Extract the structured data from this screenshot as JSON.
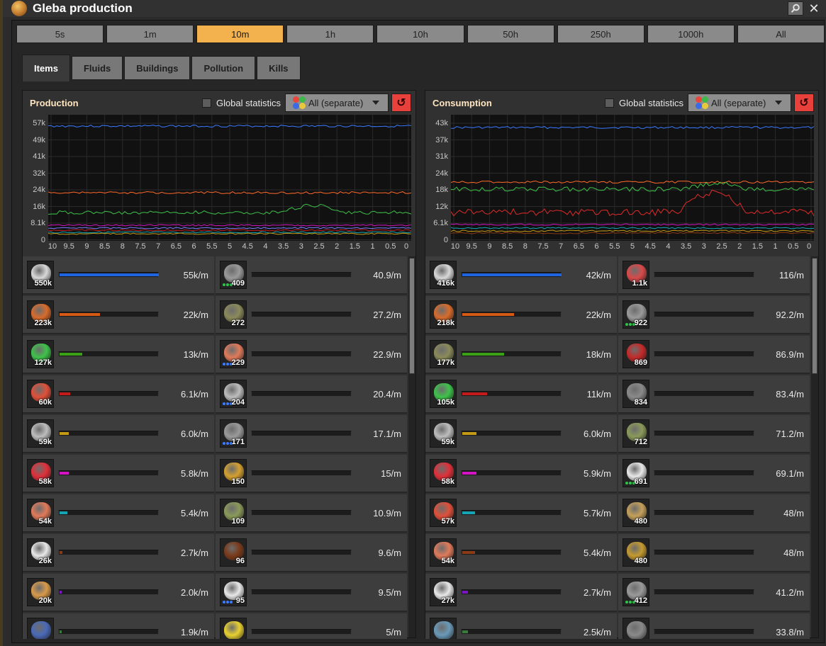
{
  "window": {
    "title": "Gleba production",
    "icon": "gleba-planet-icon"
  },
  "time_ranges": [
    {
      "label": "5s",
      "active": false
    },
    {
      "label": "1m",
      "active": false
    },
    {
      "label": "10m",
      "active": true
    },
    {
      "label": "1h",
      "active": false
    },
    {
      "label": "10h",
      "active": false
    },
    {
      "label": "50h",
      "active": false
    },
    {
      "label": "250h",
      "active": false
    },
    {
      "label": "1000h",
      "active": false
    },
    {
      "label": "All",
      "active": false
    }
  ],
  "tabs": [
    {
      "label": "Items",
      "active": true
    },
    {
      "label": "Fluids",
      "active": false
    },
    {
      "label": "Buildings",
      "active": false
    },
    {
      "label": "Pollution",
      "active": false
    },
    {
      "label": "Kills",
      "active": false
    }
  ],
  "production": {
    "title": "Production",
    "global_label": "Global statistics",
    "dropdown": "All (separate)",
    "y_ticks": [
      "57k",
      "49k",
      "41k",
      "32k",
      "24k",
      "16k",
      "8.1k",
      "0"
    ],
    "x_ticks": [
      "10",
      "9.5",
      "9",
      "8.5",
      "8",
      "7.5",
      "7",
      "6.5",
      "6",
      "5.5",
      "5",
      "4.5",
      "4",
      "3.5",
      "3",
      "2.5",
      "2",
      "1.5",
      "1",
      "0.5",
      "0"
    ],
    "rows": [
      [
        {
          "count": "550k",
          "rate": "55k/m",
          "fill": 1.0,
          "bar": "#1e63e0",
          "icon": "stone-icon",
          "ic": "#d8d8d8",
          "dots": ""
        },
        {
          "count": "409",
          "rate": "40.9/m",
          "fill": 0,
          "bar": "#777",
          "icon": "iron-stick-icon",
          "ic": "#9a9a9a",
          "dots": "#2cc44a"
        }
      ],
      [
        {
          "count": "223k",
          "rate": "22k/m",
          "fill": 0.41,
          "bar": "#d75a14",
          "icon": "yumako-icon",
          "ic": "#d86b2c",
          "dots": ""
        },
        {
          "count": "272",
          "rate": "27.2/m",
          "fill": 0,
          "bar": "#777",
          "icon": "jellynut-seed-icon",
          "ic": "#8a8a5a",
          "dots": ""
        }
      ],
      [
        {
          "count": "127k",
          "rate": "13k/m",
          "fill": 0.23,
          "bar": "#3aa114",
          "icon": "nutrients-icon",
          "ic": "#3ec24a",
          "dots": ""
        },
        {
          "count": "229",
          "rate": "22.9/m",
          "fill": 0,
          "bar": "#777",
          "icon": "copper-plate-icon",
          "ic": "#e07a5a",
          "dots": "#3a7aff"
        }
      ],
      [
        {
          "count": "60k",
          "rate": "6.1k/m",
          "fill": 0.11,
          "bar": "#c41a1a",
          "icon": "bioflux-icon",
          "ic": "#e0503a",
          "dots": ""
        },
        {
          "count": "204",
          "rate": "20.4/m",
          "fill": 0,
          "bar": "#777",
          "icon": "iron-plate-icon",
          "ic": "#bdbdbd",
          "dots": "#3a7aff"
        }
      ],
      [
        {
          "count": "59k",
          "rate": "6.0k/m",
          "fill": 0.09,
          "bar": "#c49a14",
          "icon": "iron-plate-icon",
          "ic": "#bdbdbd",
          "dots": ""
        },
        {
          "count": "171",
          "rate": "17.1/m",
          "fill": 0,
          "bar": "#777",
          "icon": "iron-stick-icon",
          "ic": "#9a9a9a",
          "dots": "#3a7aff"
        }
      ],
      [
        {
          "count": "58k",
          "rate": "5.8k/m",
          "fill": 0.09,
          "bar": "#d414c4",
          "icon": "jellynut-icon",
          "ic": "#e0303a",
          "dots": ""
        },
        {
          "count": "150",
          "rate": "15/m",
          "fill": 0,
          "bar": "#777",
          "icon": "agricultural-science-pack-icon",
          "ic": "#d4a030",
          "dots": ""
        }
      ],
      [
        {
          "count": "54k",
          "rate": "5.4k/m",
          "fill": 0.08,
          "bar": "#14a4b4",
          "icon": "copper-plate-icon",
          "ic": "#e07a5a",
          "dots": ""
        },
        {
          "count": "109",
          "rate": "10.9/m",
          "fill": 0,
          "bar": "#777",
          "icon": "rocket-part-icon",
          "ic": "#8a9a5a",
          "dots": ""
        }
      ],
      [
        {
          "count": "26k",
          "rate": "2.7k/m",
          "fill": 0.03,
          "bar": "#8a3a14",
          "icon": "plastic-bar-icon",
          "ic": "#e8e8e8",
          "dots": ""
        },
        {
          "count": "96",
          "rate": "9.6/m",
          "fill": 0,
          "bar": "#777",
          "icon": "carbon-fiber-icon",
          "ic": "#7a3a1a",
          "dots": ""
        }
      ],
      [
        {
          "count": "20k",
          "rate": "2.0k/m",
          "fill": 0.02,
          "bar": "#7a14c4",
          "icon": "yumako-mash-icon",
          "ic": "#d89a4a",
          "dots": ""
        },
        {
          "count": "95",
          "rate": "9.5/m",
          "fill": 0,
          "bar": "#777",
          "icon": "plastic-bar-icon",
          "ic": "#e8e8e8",
          "dots": "#3a7aff"
        }
      ],
      [
        {
          "count": "",
          "rate": "1.9k/m",
          "fill": 0.02,
          "bar": "#3a7a3a",
          "icon": "carbon-icon",
          "ic": "#4a6ab8",
          "dots": ""
        },
        {
          "count": "",
          "rate": "5/m",
          "fill": 0,
          "bar": "#777",
          "icon": "sulfur-icon",
          "ic": "#e8d030",
          "dots": ""
        }
      ]
    ]
  },
  "consumption": {
    "title": "Consumption",
    "global_label": "Global statistics",
    "dropdown": "All (separate)",
    "y_ticks": [
      "43k",
      "37k",
      "31k",
      "24k",
      "18k",
      "12k",
      "6.1k",
      "0"
    ],
    "x_ticks": [
      "10",
      "9.5",
      "9",
      "8.5",
      "8",
      "7.5",
      "7",
      "6.5",
      "6",
      "5.5",
      "5",
      "4.5",
      "4",
      "3.5",
      "3",
      "2.5",
      "2",
      "1.5",
      "1",
      "0.5",
      "0"
    ],
    "rows": [
      [
        {
          "count": "416k",
          "rate": "42k/m",
          "fill": 1.0,
          "bar": "#1e63e0",
          "icon": "stone-icon",
          "ic": "#d8d8d8",
          "dots": ""
        },
        {
          "count": "1.1k",
          "rate": "116/m",
          "fill": 0,
          "bar": "#777",
          "icon": "pentapod-egg-icon",
          "ic": "#d84a4a",
          "dots": ""
        }
      ],
      [
        {
          "count": "218k",
          "rate": "22k/m",
          "fill": 0.52,
          "bar": "#d75a14",
          "icon": "yumako-icon",
          "ic": "#d86b2c",
          "dots": ""
        },
        {
          "count": "922",
          "rate": "92.2/m",
          "fill": 0,
          "bar": "#777",
          "icon": "iron-gear-icon",
          "ic": "#9a9a9a",
          "dots": "#2cc44a"
        }
      ],
      [
        {
          "count": "177k",
          "rate": "18k/m",
          "fill": 0.42,
          "bar": "#3aa114",
          "icon": "jellynut-seed-icon",
          "ic": "#8a8a5a",
          "dots": ""
        },
        {
          "count": "869",
          "rate": "86.9/m",
          "fill": 0,
          "bar": "#777",
          "icon": "advanced-circuit-icon",
          "ic": "#c42a2a",
          "dots": ""
        }
      ],
      [
        {
          "count": "105k",
          "rate": "11k/m",
          "fill": 0.25,
          "bar": "#c41a1a",
          "icon": "nutrients-icon",
          "ic": "#3ec24a",
          "dots": ""
        },
        {
          "count": "834",
          "rate": "83.4/m",
          "fill": 0,
          "bar": "#777",
          "icon": "spoilage-icon",
          "ic": "#8a8a8a",
          "dots": ""
        }
      ],
      [
        {
          "count": "59k",
          "rate": "6.0k/m",
          "fill": 0.14,
          "bar": "#c49a14",
          "icon": "iron-plate-icon",
          "ic": "#bdbdbd",
          "dots": ""
        },
        {
          "count": "712",
          "rate": "71.2/m",
          "fill": 0,
          "bar": "#777",
          "icon": "rocket-part-icon",
          "ic": "#8a9a5a",
          "dots": ""
        }
      ],
      [
        {
          "count": "58k",
          "rate": "5.9k/m",
          "fill": 0.14,
          "bar": "#d414c4",
          "icon": "jellynut-icon",
          "ic": "#e0303a",
          "dots": ""
        },
        {
          "count": "691",
          "rate": "69.1/m",
          "fill": 0,
          "bar": "#777",
          "icon": "plastic-bar-icon",
          "ic": "#e8e8e8",
          "dots": "#2cc44a"
        }
      ],
      [
        {
          "count": "57k",
          "rate": "5.7k/m",
          "fill": 0.13,
          "bar": "#14a4b4",
          "icon": "bioflux-icon",
          "ic": "#e0503a",
          "dots": ""
        },
        {
          "count": "480",
          "rate": "48/m",
          "fill": 0,
          "bar": "#777",
          "icon": "engine-unit-icon",
          "ic": "#c4a05a",
          "dots": ""
        }
      ],
      [
        {
          "count": "54k",
          "rate": "5.4k/m",
          "fill": 0.13,
          "bar": "#8a3a14",
          "icon": "copper-plate-icon",
          "ic": "#e07a5a",
          "dots": ""
        },
        {
          "count": "480",
          "rate": "48/m",
          "fill": 0,
          "bar": "#777",
          "icon": "battery-icon",
          "ic": "#c49a30",
          "dots": ""
        }
      ],
      [
        {
          "count": "27k",
          "rate": "2.7k/m",
          "fill": 0.06,
          "bar": "#7a14c4",
          "icon": "plastic-bar-icon",
          "ic": "#e8e8e8",
          "dots": ""
        },
        {
          "count": "412",
          "rate": "41.2/m",
          "fill": 0,
          "bar": "#777",
          "icon": "iron-stick-icon",
          "ic": "#9a9a9a",
          "dots": "#2cc44a"
        }
      ],
      [
        {
          "count": "",
          "rate": "2.5k/m",
          "fill": 0.06,
          "bar": "#3a7a3a",
          "icon": "carbon-icon",
          "ic": "#6a9ab8",
          "dots": ""
        },
        {
          "count": "",
          "rate": "33.8/m",
          "fill": 0,
          "bar": "#777",
          "icon": "coal-icon",
          "ic": "#8a8a8a",
          "dots": ""
        }
      ]
    ]
  }
}
